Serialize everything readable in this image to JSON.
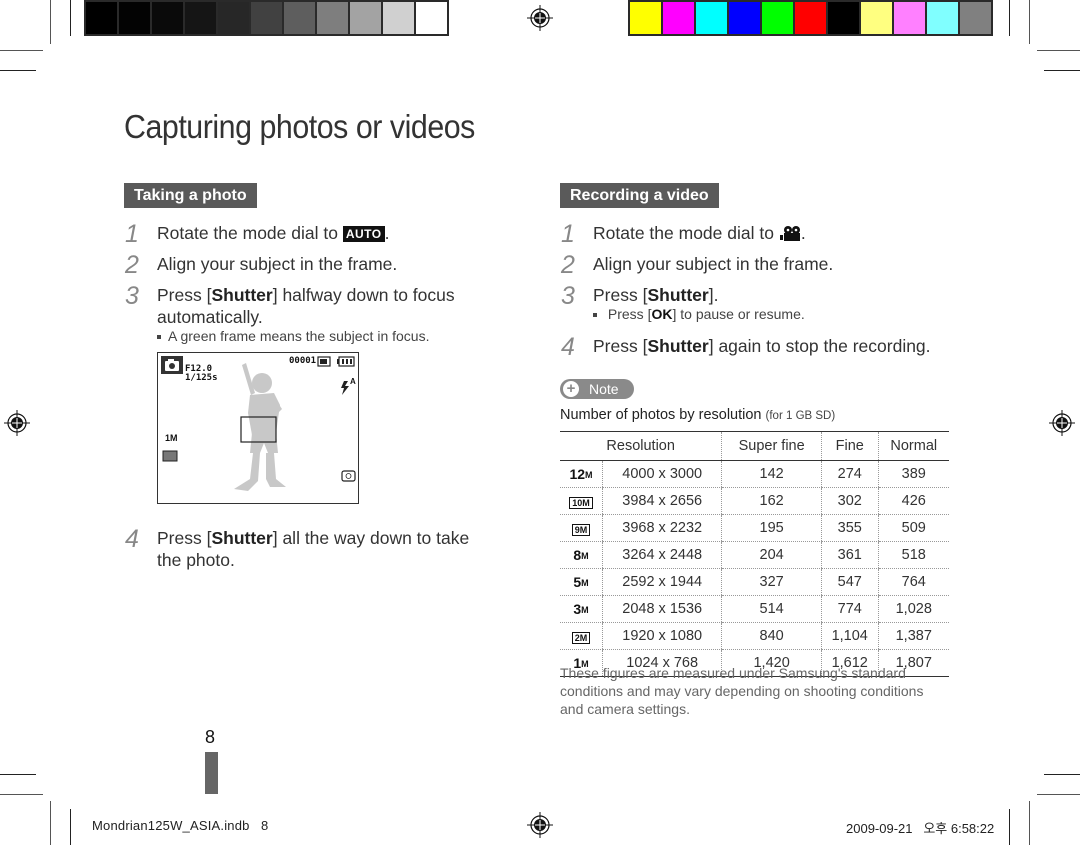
{
  "print_marks": {
    "grayscale_swatches": [
      "#000000",
      "#030303",
      "#0a0a0a",
      "#151515",
      "#272727",
      "#414141",
      "#5e5e5e",
      "#7e7e7e",
      "#a3a3a3",
      "#d0d0d0",
      "#ffffff"
    ],
    "color_swatches": [
      "#ffff00",
      "#ff00ff",
      "#00ffff",
      "#0000ff",
      "#00ff00",
      "#ff0000",
      "#000000",
      "#ffff80",
      "#ff80ff",
      "#80ffff",
      "#808080"
    ]
  },
  "page": {
    "title": "Capturing photos or videos",
    "page_number": "8"
  },
  "taking_photo": {
    "heading": "Taking a photo",
    "steps": [
      {
        "num": "1",
        "pre": "Rotate the mode dial to ",
        "badge": "AUTO",
        "post": "."
      },
      {
        "num": "2",
        "text": "Align your subject in the frame."
      },
      {
        "num": "3",
        "pre": "Press [",
        "bold": "Shutter",
        "post": "] halfway down to focus automatically."
      },
      {
        "num": "4",
        "pre": "Press [",
        "bold": "Shutter",
        "post": "] all the way down to take the photo."
      }
    ],
    "bullet": "A green frame means the subject in focus.",
    "preview": {
      "aperture": "F12.0",
      "shutter": "1/125s",
      "shot_count": "00001",
      "size_label": "1M",
      "flash_label": "A"
    }
  },
  "recording_video": {
    "heading": "Recording a video",
    "steps": [
      {
        "num": "1",
        "pre": "Rotate the mode dial to ",
        "post": "."
      },
      {
        "num": "2",
        "text": "Align your subject in the frame."
      },
      {
        "num": "3",
        "pre": "Press [",
        "bold": "Shutter",
        "post": "]."
      },
      {
        "num": "4",
        "pre": "Press [",
        "bold": "Shutter",
        "post": "] again to stop the recording."
      }
    ],
    "bullet_pre": "Press [",
    "bullet_key": "OK",
    "bullet_post": "] to pause or resume."
  },
  "note": {
    "label": "Note",
    "table_title": "Number of photos by resolution",
    "table_subtitle": "(for 1 GB SD)",
    "headers": [
      "Resolution",
      "Super fine",
      "Fine",
      "Normal"
    ],
    "rows": [
      {
        "icon": "12M",
        "res": "4000 x 3000",
        "super_fine": "142",
        "fine": "274",
        "normal": "389"
      },
      {
        "icon": "10M",
        "res": "3984 x 2656",
        "super_fine": "162",
        "fine": "302",
        "normal": "426"
      },
      {
        "icon": "9M",
        "res": "3968 x 2232",
        "super_fine": "195",
        "fine": "355",
        "normal": "509"
      },
      {
        "icon": "8M",
        "res": "3264 x 2448",
        "super_fine": "204",
        "fine": "361",
        "normal": "518"
      },
      {
        "icon": "5M",
        "res": "2592 x 1944",
        "super_fine": "327",
        "fine": "547",
        "normal": "764"
      },
      {
        "icon": "3M",
        "res": "2048 x 1536",
        "super_fine": "514",
        "fine": "774",
        "normal": "1,028"
      },
      {
        "icon": "2M",
        "res": "1920 x 1080",
        "super_fine": "840",
        "fine": "1,104",
        "normal": "1,387"
      },
      {
        "icon": "1M",
        "res": "1024 x 768",
        "super_fine": "1,420",
        "fine": "1,612",
        "normal": "1,807"
      }
    ],
    "footnote": "These figures are measured under Samsung's standard conditions and may vary depending on shooting conditions and camera settings."
  },
  "footer": {
    "slug": "Mondrian125W_ASIA.indb   8",
    "timestamp": "2009-09-21   오후 6:58:22"
  }
}
